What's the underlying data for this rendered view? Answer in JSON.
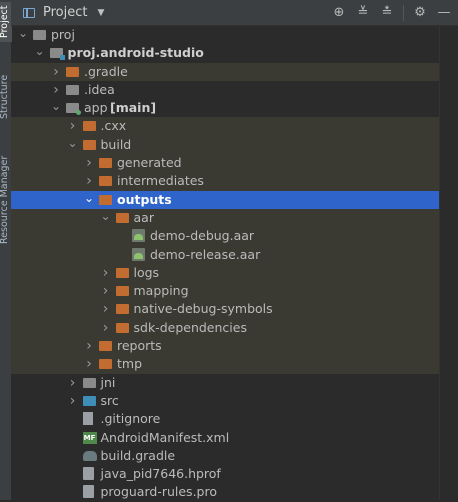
{
  "left_strip": {
    "tabs": [
      "Project",
      "Structure",
      "Resource Manager"
    ]
  },
  "header": {
    "title": "Project",
    "tools": [
      "locate-icon",
      "expand-all-icon",
      "collapse-all-icon",
      "gear-icon",
      "hide-icon"
    ]
  },
  "tree": [
    {
      "label": "proj",
      "depth": 0,
      "arrow": "down",
      "icon": "folder-grey",
      "bold": false,
      "hl": false,
      "sel": false
    },
    {
      "label": "proj.android-studio",
      "depth": 1,
      "arrow": "down",
      "icon": "folder-proj",
      "bold": true,
      "hl": false,
      "sel": false
    },
    {
      "label": ".gradle",
      "depth": 2,
      "arrow": "right",
      "icon": "folder-orange",
      "bold": false,
      "hl": true,
      "sel": false
    },
    {
      "label": ".idea",
      "depth": 2,
      "arrow": "right",
      "icon": "folder-grey",
      "bold": false,
      "hl": false,
      "sel": false
    },
    {
      "label": "app",
      "suffix": "[main]",
      "depth": 2,
      "arrow": "down",
      "icon": "folder-module",
      "bold": false,
      "hl": false,
      "sel": false
    },
    {
      "label": ".cxx",
      "depth": 3,
      "arrow": "right",
      "icon": "folder-orange",
      "bold": false,
      "hl": true,
      "sel": false
    },
    {
      "label": "build",
      "depth": 3,
      "arrow": "down",
      "icon": "folder-orange",
      "bold": false,
      "hl": true,
      "sel": false
    },
    {
      "label": "generated",
      "depth": 4,
      "arrow": "right",
      "icon": "folder-orange",
      "bold": false,
      "hl": true,
      "sel": false
    },
    {
      "label": "intermediates",
      "depth": 4,
      "arrow": "right",
      "icon": "folder-orange",
      "bold": false,
      "hl": true,
      "sel": false
    },
    {
      "label": "outputs",
      "depth": 4,
      "arrow": "down",
      "icon": "folder-orange",
      "bold": true,
      "hl": false,
      "sel": true
    },
    {
      "label": "aar",
      "depth": 5,
      "arrow": "down",
      "icon": "folder-orange",
      "bold": false,
      "hl": true,
      "sel": false
    },
    {
      "label": "demo-debug.aar",
      "depth": 6,
      "arrow": "",
      "icon": "aar",
      "bold": false,
      "hl": true,
      "sel": false
    },
    {
      "label": "demo-release.aar",
      "depth": 6,
      "arrow": "",
      "icon": "aar",
      "bold": false,
      "hl": true,
      "sel": false
    },
    {
      "label": "logs",
      "depth": 5,
      "arrow": "right",
      "icon": "folder-orange",
      "bold": false,
      "hl": true,
      "sel": false
    },
    {
      "label": "mapping",
      "depth": 5,
      "arrow": "right",
      "icon": "folder-orange",
      "bold": false,
      "hl": true,
      "sel": false
    },
    {
      "label": "native-debug-symbols",
      "depth": 5,
      "arrow": "right",
      "icon": "folder-orange",
      "bold": false,
      "hl": true,
      "sel": false
    },
    {
      "label": "sdk-dependencies",
      "depth": 5,
      "arrow": "right",
      "icon": "folder-orange",
      "bold": false,
      "hl": true,
      "sel": false
    },
    {
      "label": "reports",
      "depth": 4,
      "arrow": "right",
      "icon": "folder-orange",
      "bold": false,
      "hl": true,
      "sel": false
    },
    {
      "label": "tmp",
      "depth": 4,
      "arrow": "right",
      "icon": "folder-orange",
      "bold": false,
      "hl": true,
      "sel": false
    },
    {
      "label": "jni",
      "depth": 3,
      "arrow": "right",
      "icon": "folder-grey",
      "bold": false,
      "hl": false,
      "sel": false
    },
    {
      "label": "src",
      "depth": 3,
      "arrow": "right",
      "icon": "folder-blue",
      "bold": false,
      "hl": false,
      "sel": false
    },
    {
      "label": ".gitignore",
      "depth": 3,
      "arrow": "",
      "icon": "gitignore",
      "bold": false,
      "hl": false,
      "sel": false
    },
    {
      "label": "AndroidManifest.xml",
      "depth": 3,
      "arrow": "",
      "icon": "manifest",
      "bold": false,
      "hl": false,
      "sel": false
    },
    {
      "label": "build.gradle",
      "depth": 3,
      "arrow": "",
      "icon": "gradle",
      "bold": false,
      "hl": false,
      "sel": false
    },
    {
      "label": "java_pid7646.hprof",
      "depth": 3,
      "arrow": "",
      "icon": "file",
      "bold": false,
      "hl": false,
      "sel": false
    },
    {
      "label": "proguard-rules.pro",
      "depth": 3,
      "arrow": "",
      "icon": "file",
      "bold": false,
      "hl": false,
      "sel": false
    }
  ],
  "colors": {
    "background": "#2b2b2b",
    "highlight": "#3b3a32",
    "selection": "#2f65ca",
    "folder": "#c26c31"
  }
}
